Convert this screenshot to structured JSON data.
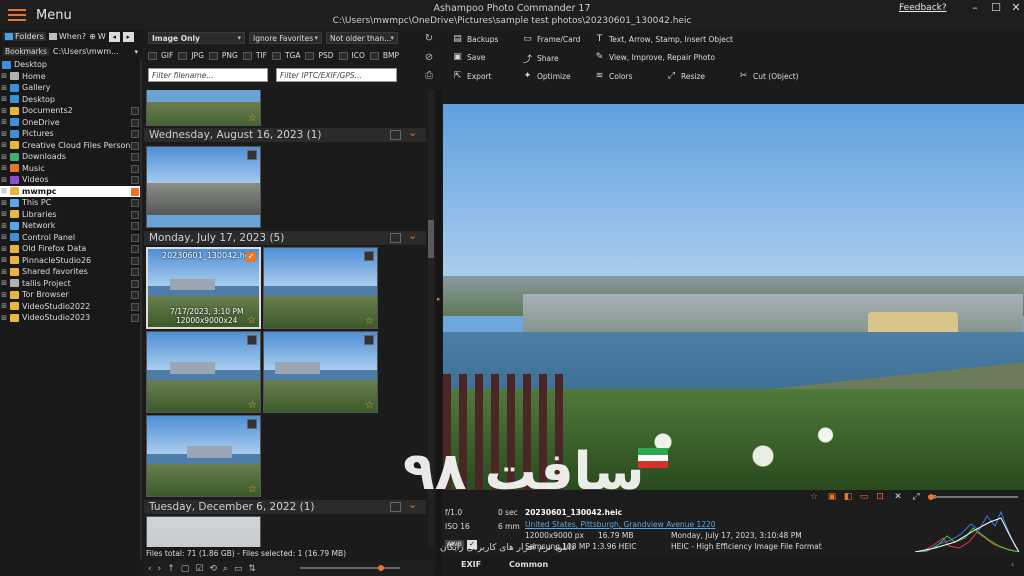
{
  "app": {
    "menu_label": "Menu",
    "title": "Ashampoo Photo Commander 17",
    "path": "C:\\Users\\mwmpc\\OneDrive\\Pictures\\sample test photos\\20230601_130042.heic",
    "feedback": "Feedback?",
    "accent": "#e9772b"
  },
  "left_tabs": {
    "folders": "Folders",
    "when": "When?",
    "where": "W"
  },
  "bookmarks": {
    "label": "Bookmarks",
    "path": "C:\\Users\\mwm..."
  },
  "tree": [
    {
      "label": "Desktop",
      "icon": "desktop-icon"
    },
    {
      "label": "Home",
      "icon": "home-icon"
    },
    {
      "label": "Gallery",
      "icon": "gallery-icon"
    },
    {
      "label": "Desktop",
      "icon": "desktop-icon"
    },
    {
      "label": "Documents2",
      "icon": "folder-icon"
    },
    {
      "label": "OneDrive",
      "icon": "cloud-icon"
    },
    {
      "label": "Pictures",
      "icon": "pictures-icon"
    },
    {
      "label": "Creative Cloud Files Person...",
      "icon": "folder-icon"
    },
    {
      "label": "Downloads",
      "icon": "download-icon"
    },
    {
      "label": "Music",
      "icon": "music-icon"
    },
    {
      "label": "Videos",
      "icon": "video-icon"
    },
    {
      "label": "mwmpc",
      "icon": "folder-icon",
      "selected": true
    },
    {
      "label": "This PC",
      "icon": "pc-icon"
    },
    {
      "label": "Libraries",
      "icon": "folder-icon"
    },
    {
      "label": "Network",
      "icon": "network-icon"
    },
    {
      "label": "Control Panel",
      "icon": "control-panel-icon"
    },
    {
      "label": "Old Firefox Data",
      "icon": "folder-icon"
    },
    {
      "label": "PinnacleStudio26",
      "icon": "folder-icon"
    },
    {
      "label": "Shared favorites",
      "icon": "folder-icon"
    },
    {
      "label": "tallis Project",
      "icon": "shortcut-icon"
    },
    {
      "label": "Tor Browser",
      "icon": "folder-icon"
    },
    {
      "label": "VideoStudio2022",
      "icon": "folder-icon"
    },
    {
      "label": "VideoStudio2023",
      "icon": "folder-icon"
    }
  ],
  "filters": {
    "type": "Image Only",
    "favorites": "Ignore Favorites",
    "age": "Not older than...",
    "formats": [
      "GIF",
      "JPG",
      "PNG",
      "TIF",
      "TGA",
      "PSD",
      "ICO",
      "BMP"
    ],
    "filename_placeholder": "Filter filename...",
    "meta_placeholder": "Filter IPTC/EXIF/GPS..."
  },
  "toolbar": {
    "backups": "Backups",
    "frame_card": "Frame/Card",
    "text_arrow": "Text, Arrow, Stamp, Insert Object",
    "save": "Save",
    "share": "Share",
    "view_improve": "View, Improve, Repair Photo",
    "export": "Export",
    "optimize": "Optimize",
    "colors": "Colors",
    "resize": "Resize",
    "cut": "Cut (Object)"
  },
  "groups": [
    {
      "label": "Wednesday, August 16, 2023 (1)"
    },
    {
      "label": "Monday, July 17, 2023 (5)"
    },
    {
      "label": "Tuesday, December 6, 2022 (1)"
    }
  ],
  "selected_thumb": {
    "name": "20230601_130042.heic",
    "date": "7/17/2023, 3:10 PM",
    "size": "12000x9000x24"
  },
  "status": "Files total: 71 (1.86 GB) - Files selected: 1 (16.79 MB)",
  "exif": {
    "aperture": "f/1.0",
    "shutter": "0 sec",
    "iso": "ISO 16",
    "focal": "6 mm",
    "filename": "20230601_130042.heic",
    "location": "United States, Pittsburgh, Grandview Avenue 1220",
    "dimensions": "12000x9000 px",
    "filesize": "16.79 MB",
    "datetime": "Monday, July 17, 2023, 3:10:48 PM",
    "camera": "Samsung 108 MP 1:3.96 HEIC",
    "format": "HEIC - High Efficiency Image File Format",
    "awb": "AWB"
  },
  "bottom_tabs": {
    "exif": "EXIF",
    "common": "Common"
  },
  "watermark": {
    "text": "سافت ۹۸",
    "sub": "دانلود نرم افزار های کاربردی رایگان"
  }
}
